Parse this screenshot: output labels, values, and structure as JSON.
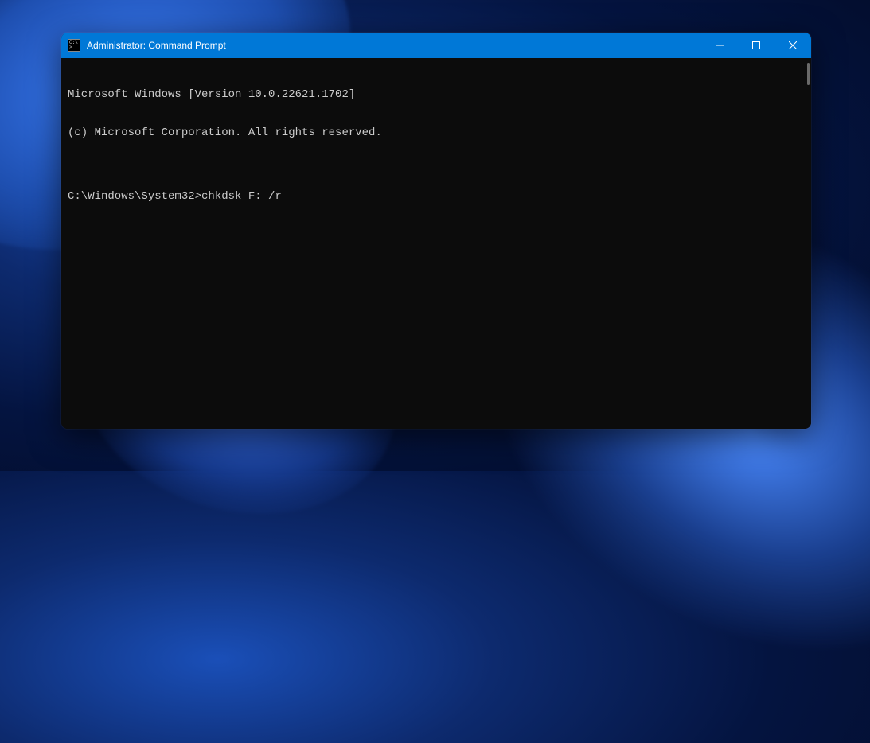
{
  "window": {
    "title": "Administrator: Command Prompt"
  },
  "terminal": {
    "line1": "Microsoft Windows [Version 10.0.22621.1702]",
    "line2": "(c) Microsoft Corporation. All rights reserved.",
    "blank": "",
    "prompt": "C:\\Windows\\System32>",
    "command": "chkdsk F: /r"
  },
  "colors": {
    "titlebar": "#0078d7",
    "terminal_bg": "#0c0c0c",
    "terminal_fg": "#cccccc"
  }
}
